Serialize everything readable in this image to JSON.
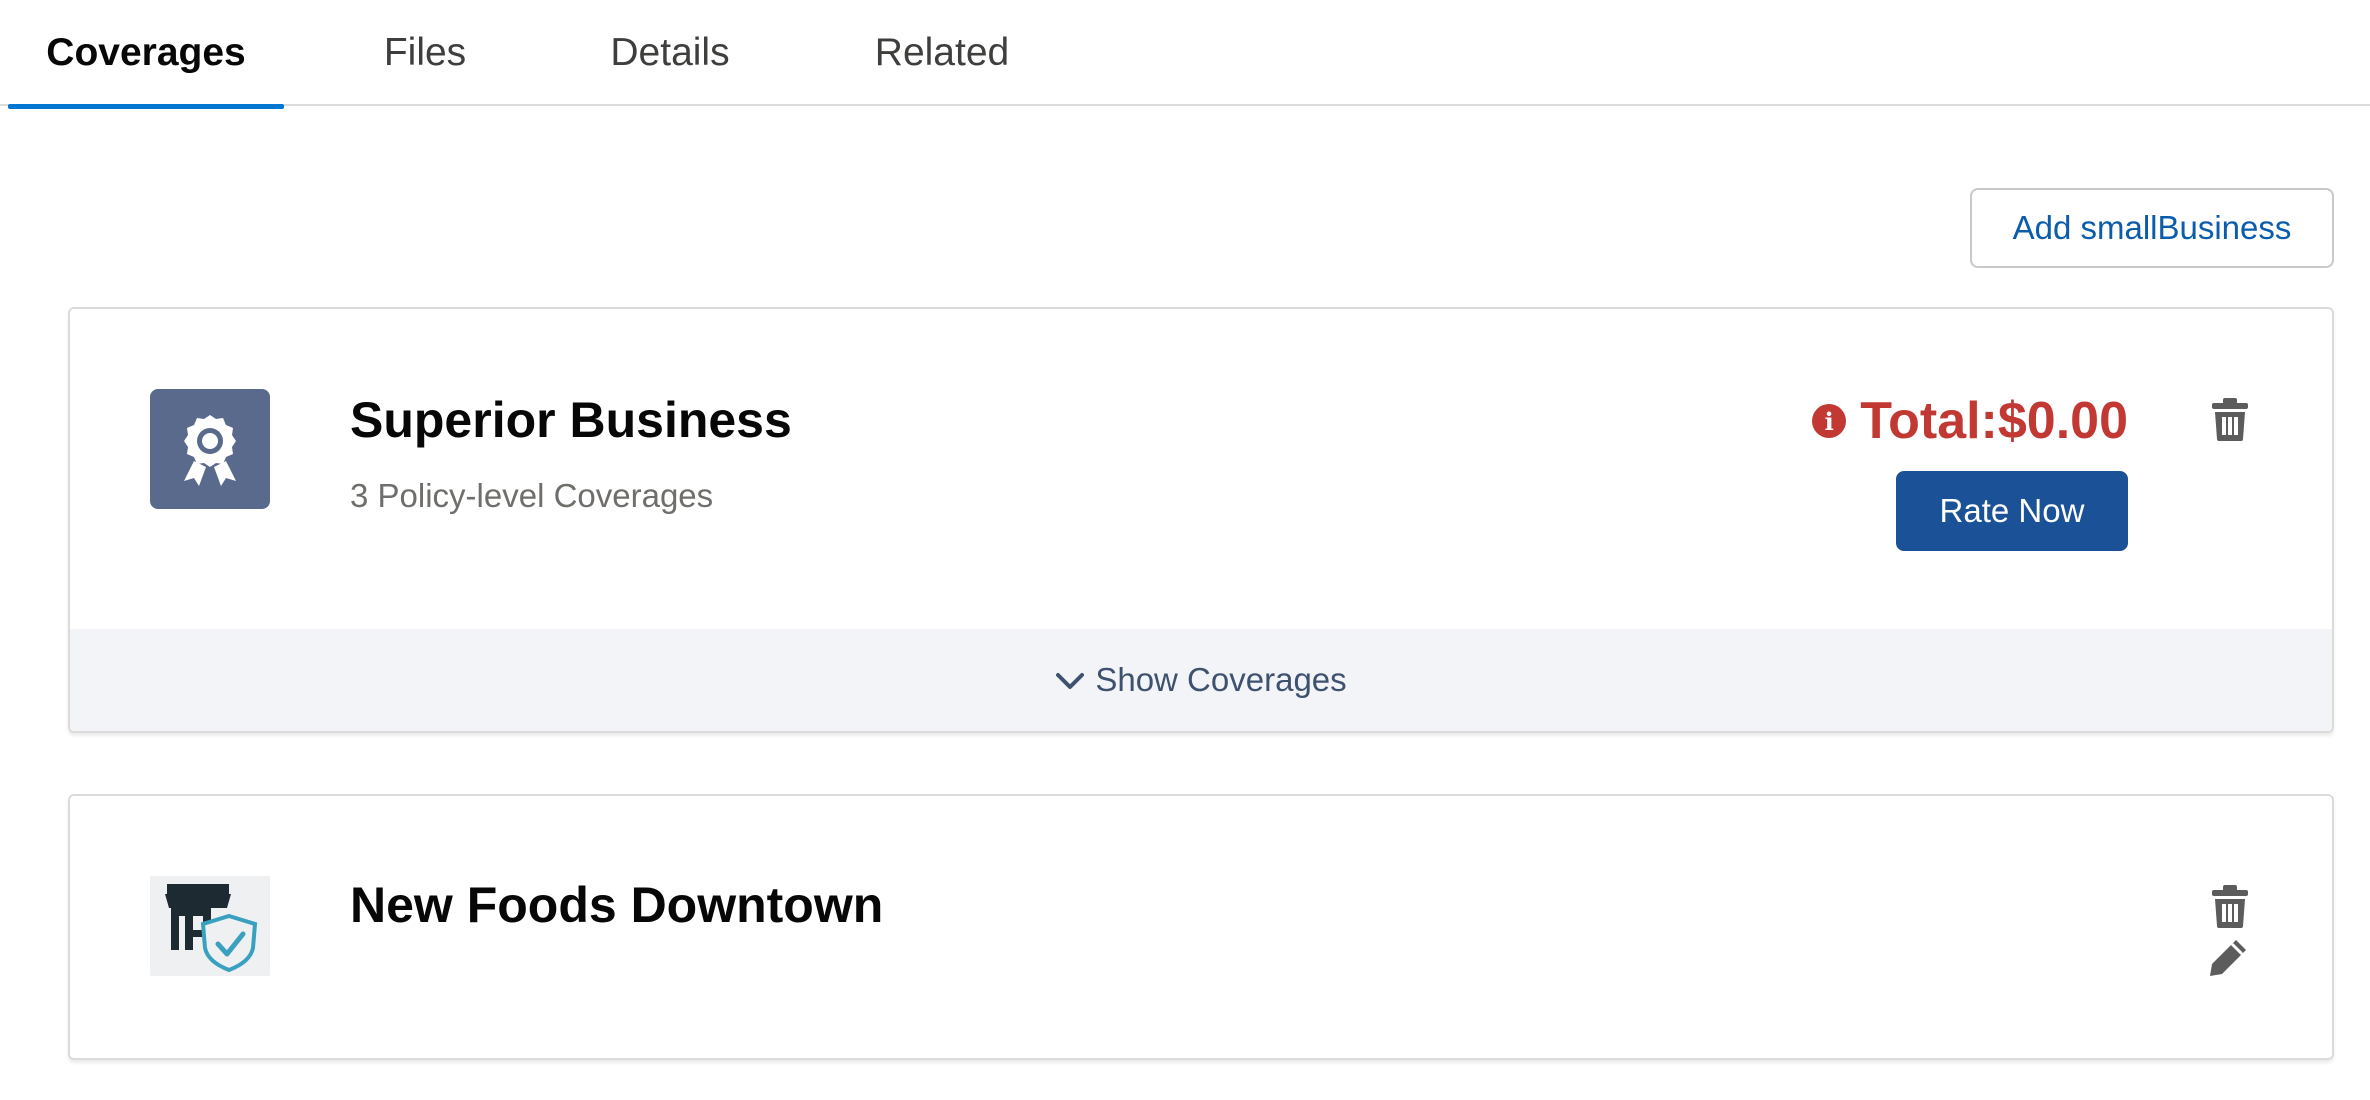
{
  "tabs": [
    {
      "label": "Coverages",
      "active": true
    },
    {
      "label": "Files",
      "active": false
    },
    {
      "label": "Details",
      "active": false
    },
    {
      "label": "Related",
      "active": false
    }
  ],
  "toolbar": {
    "add_label": "Add smallBusiness"
  },
  "cards": [
    {
      "title": "Superior Business",
      "subtitle": "3 Policy-level Coverages",
      "total_label": "Total:$0.00",
      "rate_label": "Rate Now",
      "footer_label": "Show Coverages",
      "icon": "award-ribbon-icon"
    },
    {
      "title": "New Foods Downtown",
      "icon": "storefront-shield-icon"
    }
  ],
  "colors": {
    "accent": "#0176d3",
    "brand_button": "#1b5297",
    "error": "#c23934",
    "icon_tile": "#596a8c"
  }
}
